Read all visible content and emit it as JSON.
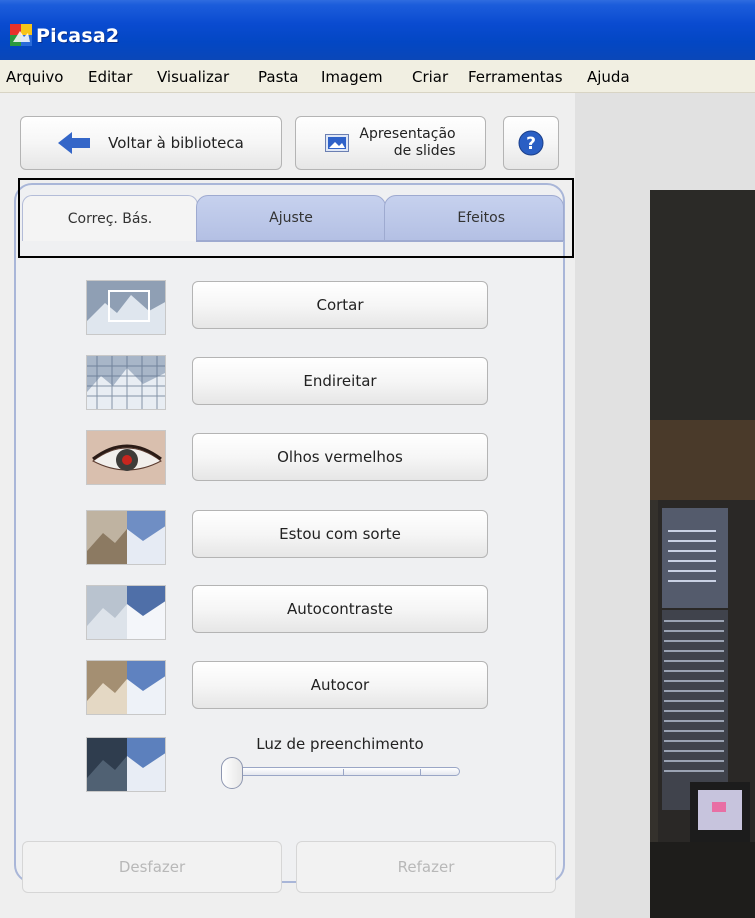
{
  "window": {
    "title": "Picasa2",
    "title_bar_color": "#0a4bd0"
  },
  "menu": [
    "Arquivo",
    "Editar",
    "Visualizar",
    "Pasta",
    "Imagem",
    "Criar",
    "Ferramentas",
    "Ajuda"
  ],
  "toolbar": {
    "back_label": "Voltar à biblioteca",
    "back_icon": "back-arrow-icon",
    "slideshow_label_line1": "Apresentação",
    "slideshow_label_line2": "de slides",
    "slideshow_icon": "slideshow-icon",
    "help_icon": "help-icon",
    "help_glyph": "?"
  },
  "tabs": [
    {
      "label": "Correç. Bás.",
      "active": true
    },
    {
      "label": "Ajuste",
      "active": false
    },
    {
      "label": "Efeitos",
      "active": false
    }
  ],
  "actions": [
    {
      "label": "Cortar",
      "thumb": "crop-thumbnail"
    },
    {
      "label": "Endireitar",
      "thumb": "straighten-thumbnail"
    },
    {
      "label": "Olhos vermelhos",
      "thumb": "redeye-thumbnail"
    },
    {
      "label": "Estou com sorte",
      "thumb": "lucky-thumbnail"
    },
    {
      "label": "Autocontraste",
      "thumb": "autocontrast-thumbnail"
    },
    {
      "label": "Autocor",
      "thumb": "autocolor-thumbnail"
    }
  ],
  "fill_light": {
    "label": "Luz de preenchimento",
    "value": 0
  },
  "history": {
    "undo_label": "Desfazer",
    "redo_label": "Refazer",
    "enabled": false
  },
  "colors": {
    "accent": "#a9b6d8",
    "panel_bg": "#efefef",
    "tab_inactive": "#bfcaea"
  }
}
